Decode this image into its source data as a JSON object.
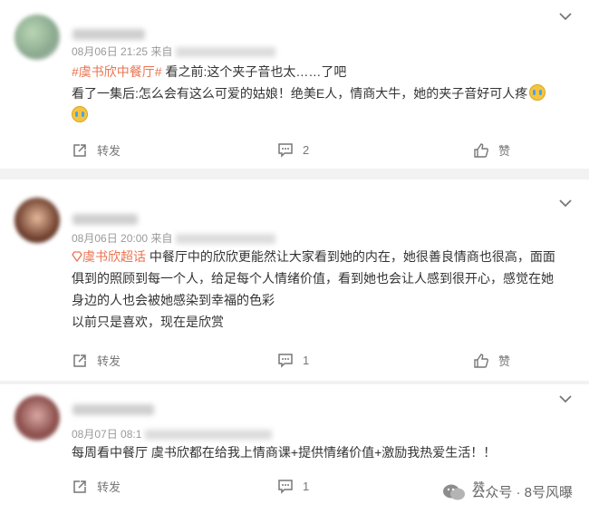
{
  "posts": [
    {
      "meta": "08月06日 21:25  来自",
      "tag": "#虞书欣中餐厅#",
      "text": " 看之前:这个夹子音也太……了吧",
      "text2": "看了一集后:怎么会有这么可爱的姑娘！绝美E人，情商大牛，她的夹子音好可人疼",
      "repost": "转发",
      "comments": "2",
      "like": "赞"
    },
    {
      "meta": "08月06日 20:00  来自",
      "supertopic": "虞书欣超话",
      "line1": " 中餐厅中的欣欣更能然让大家看到她的内在，她很善良情商也很高，面面",
      "line2": "俱到的照顾到每一个人，给足每个人情绪价值，看到她也会让人感到很开心，感觉在她",
      "line3": "身边的人也会被她感染到幸福的色彩",
      "line4": "以前只是喜欢，现在是欣赏",
      "repost": "转发",
      "comments": "1",
      "like": "赞"
    },
    {
      "meta": "08月07日 08:1",
      "text": "每周看中餐厅 虞书欣都在给我上情商课+提供情绪价值+激励我热爱生活！！",
      "repost": "转发",
      "comments": "1",
      "like": "赞"
    }
  ],
  "watermark": "公众号 · 8号风曝"
}
